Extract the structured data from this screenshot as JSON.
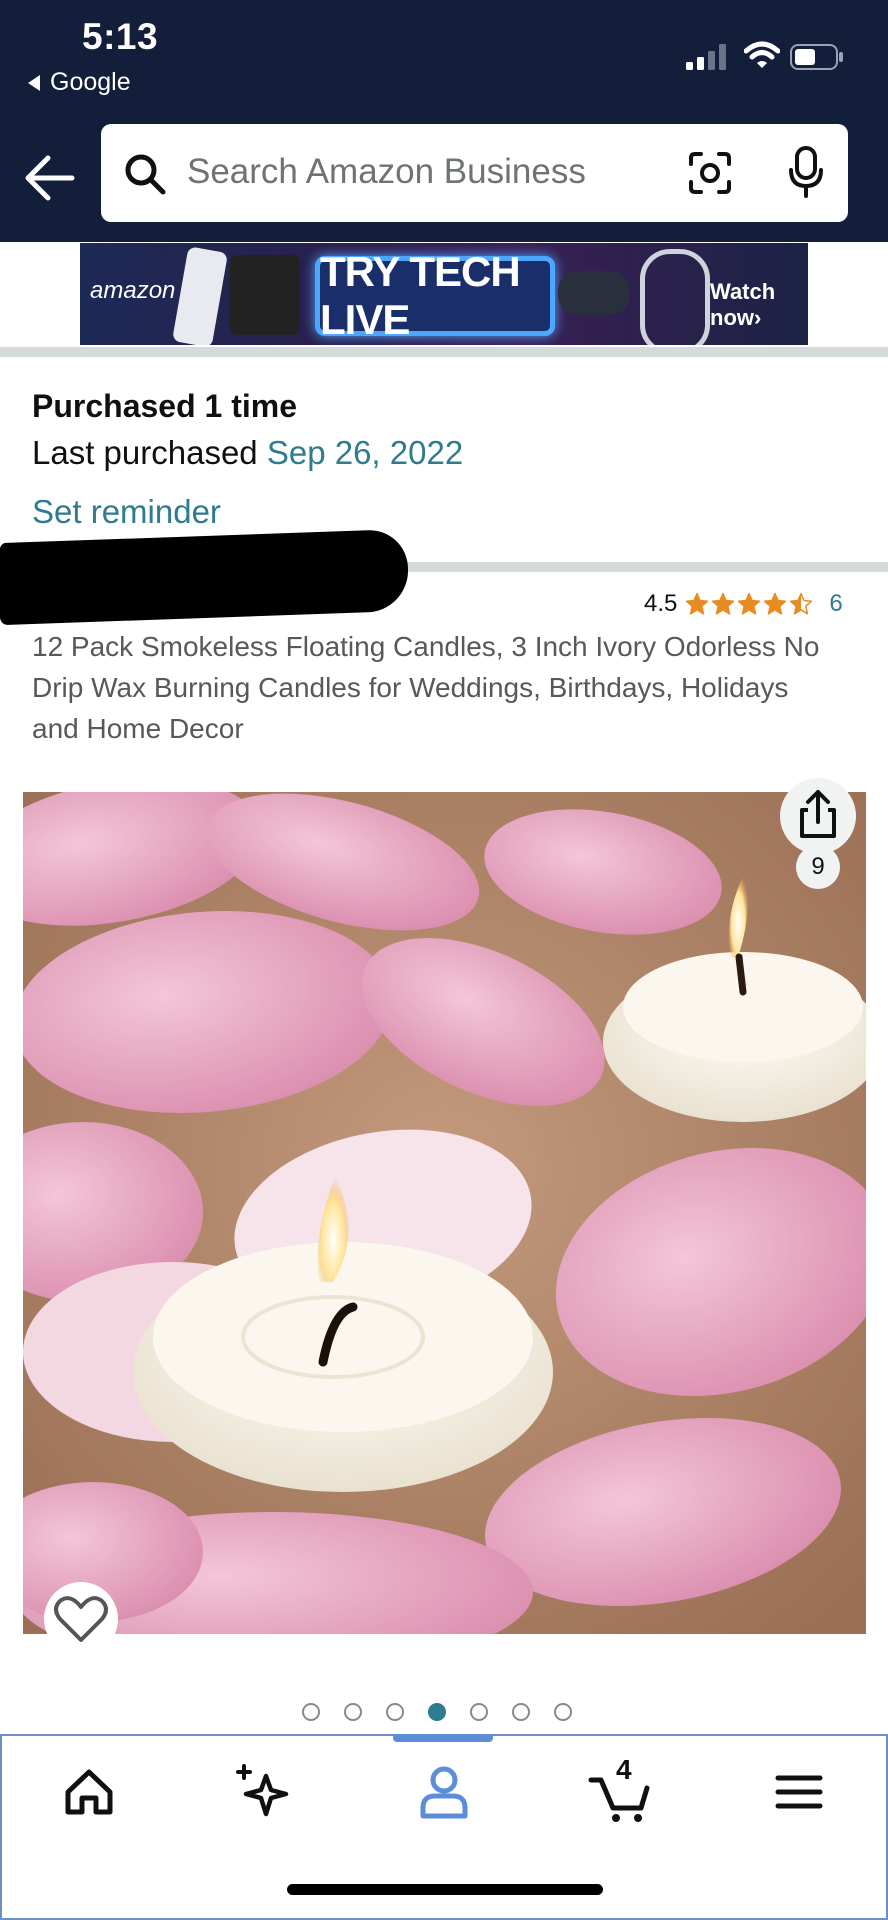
{
  "status_bar": {
    "time": "5:13",
    "back_app_label": "Google",
    "icons": [
      "cellular-signal-icon",
      "wifi-icon",
      "battery-icon"
    ]
  },
  "search": {
    "placeholder": "Search Amazon Business",
    "icons": [
      "back-arrow-icon",
      "search-icon",
      "camera-icon",
      "microphone-icon"
    ]
  },
  "banner": {
    "logo_text": "amazon live",
    "cta_text": "TRY TECH LIVE",
    "watch_text": "Watch now›"
  },
  "purchase_info": {
    "purchased_text": "Purchased 1 time",
    "last_purchased_label": "Last purchased",
    "last_purchased_date": "Sep 26, 2022",
    "set_reminder": "Set reminder"
  },
  "product": {
    "rating_value": "4.5",
    "rating_stars": 4.5,
    "rating_count": "6",
    "title": "12 Pack Smokeless Floating Candles, 3 Inch Ivory Odorless No Drip Wax Burning Candles for Weddings, Birthdays, Holidays and Home Decor",
    "image_count": "9",
    "image_description_icon": "candle-image"
  },
  "carousel": {
    "total_dots": 7,
    "active_index": 3
  },
  "bottom_nav": {
    "items": [
      {
        "name": "home",
        "icon": "home-icon"
      },
      {
        "name": "ai-assistant",
        "icon": "sparkle-icon"
      },
      {
        "name": "account",
        "icon": "person-icon",
        "active": true
      },
      {
        "name": "cart",
        "icon": "cart-icon"
      },
      {
        "name": "menu",
        "icon": "hamburger-menu-icon"
      }
    ],
    "cart_count": "4"
  },
  "colors": {
    "header_bg": "#131e3a",
    "link": "#2f7b8f",
    "star": "#e98b20",
    "active_nav": "#5b8dd9"
  }
}
